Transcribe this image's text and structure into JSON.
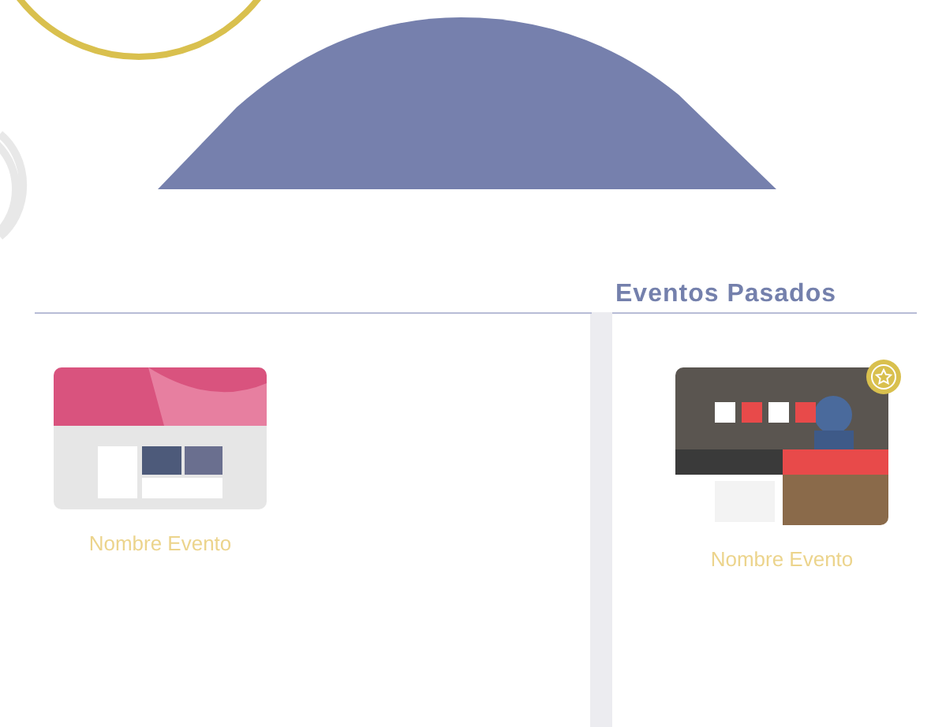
{
  "section": {
    "title": "Eventos Pasados"
  },
  "events": [
    {
      "name": "Nombre Evento",
      "featured": false,
      "kind": "pink"
    },
    {
      "name": "Nombre Evento",
      "featured": true,
      "kind": "dark"
    }
  ]
}
